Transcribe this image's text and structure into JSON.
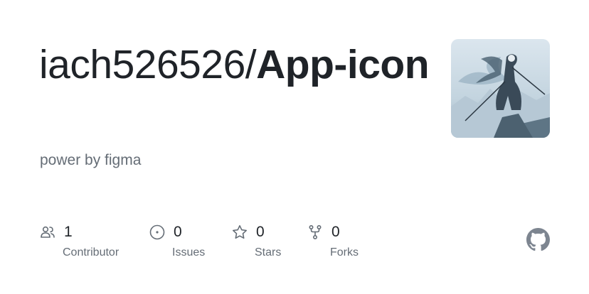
{
  "repo": {
    "owner": "iach526526/",
    "name": "App-icon",
    "description": "power by figma"
  },
  "stats": [
    {
      "count": "1",
      "label": "Contributor",
      "icon": "people-icon"
    },
    {
      "count": "0",
      "label": "Issues",
      "icon": "issue-opened-icon"
    },
    {
      "count": "0",
      "label": "Stars",
      "icon": "star-icon"
    },
    {
      "count": "0",
      "label": "Forks",
      "icon": "repo-forked-icon"
    }
  ],
  "colors": {
    "text_primary": "#1f2328",
    "text_muted": "#656d76",
    "icon": "#656d76",
    "github_logo": "#7d8590"
  },
  "avatar_icon": "warrior-illustration-avatar"
}
